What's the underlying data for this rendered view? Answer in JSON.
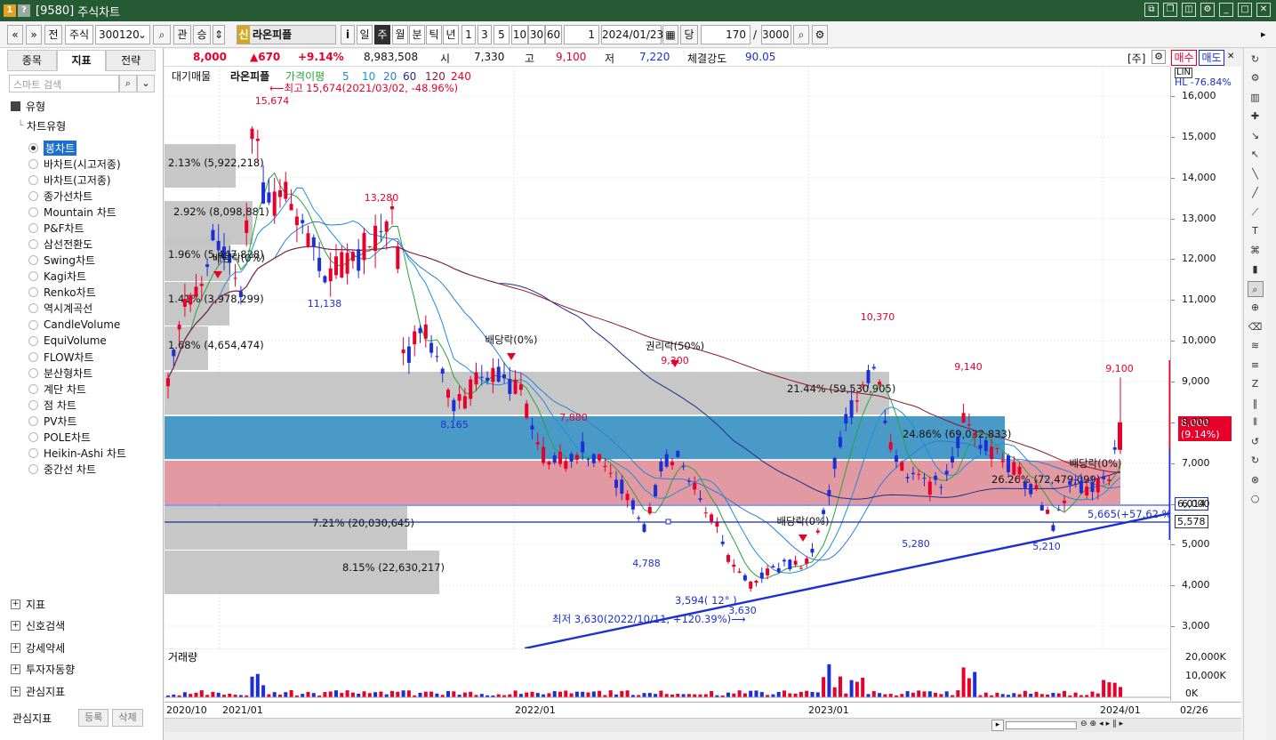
{
  "window": {
    "code": "[9580]",
    "title": "주식차트",
    "badges": [
      "1",
      "?"
    ]
  },
  "toolbar": {
    "nav_prev": "«",
    "nav_down": "»",
    "btn_prev": "전",
    "market": "주식",
    "code": "300120",
    "icon_search": "⌕",
    "btn_gwan": "관",
    "btn_sang": "승",
    "badge_sin": "신",
    "stock_name": "라온피플",
    "icon_info": "i",
    "periods": [
      "일",
      "주",
      "월",
      "분",
      "틱",
      "년"
    ],
    "active_period": "주",
    "intervals": [
      "1",
      "3",
      "5",
      "10",
      "30",
      "60"
    ],
    "count_small": "1",
    "date": "2024/01/23",
    "btn_dang": "당",
    "view_count": "170",
    "slash": "/",
    "total_count": "3000"
  },
  "sidebar": {
    "tabs": [
      "종목",
      "지표",
      "전략"
    ],
    "active_tab": "지표",
    "search_placeholder": "스마트 검색",
    "section_main": "유형",
    "group": "차트유형",
    "chart_types": [
      "봉차트",
      "바차트(시고저종)",
      "바차트(고저종)",
      "종가선차트",
      "Mountain 차트",
      "P&F차트",
      "삼선전환도",
      "Swing차트",
      "Kagi차트",
      "Renko차트",
      "역시계곡선",
      "CandleVolume",
      "EquiVolume",
      "FLOW차트",
      "분산형차트",
      "계단 차트",
      "점 차트",
      "PV차트",
      "POLE차트",
      "Heikin-Ashi 차트",
      "중간선 차트"
    ],
    "selected_type": "봉차트",
    "sections": [
      "지표",
      "신호검색",
      "강세약세",
      "투자자동향",
      "관심지표"
    ],
    "bottom_label": "관심지표",
    "btn_register": "등록",
    "btn_delete": "삭제"
  },
  "quote": {
    "price": "8,000",
    "change": "▲670",
    "change_pct": "+9.14%",
    "volume": "8,983,508",
    "open_label": "시",
    "open": "7,330",
    "high_label": "고",
    "high": "9,100",
    "low_label": "저",
    "low": "7,220",
    "strength_label": "체결강도",
    "strength": "90.05",
    "bracket": "[주]",
    "buy": "매수",
    "sell": "매도"
  },
  "legend": {
    "items": [
      "대기매물",
      "라온피플",
      "가격이평",
      "5",
      "10",
      "20",
      "60",
      "120",
      "240"
    ],
    "volume_label": "거래량"
  },
  "annotations": {
    "hl": "HL -76.84%",
    "max_note": "⟵최고 15,674(2021/03/02, -48.96%)",
    "min_note": "최저 3,630(2022/10/11, +120.39%)⟶",
    "div1": "배당락(0%)",
    "div2": "배당락(0%)",
    "div3": "배당락(0%)",
    "div4": "배당락(0%)",
    "rights": "권리락(50%)",
    "trend": "5,665(+57.62 %)",
    "angle": "3,594( 12° )"
  },
  "price_labels": [
    "15,674",
    "13,280",
    "11,138",
    "8,165",
    "7,880",
    "9,300",
    "4,788",
    "3,630",
    "10,370",
    "5,280",
    "9,140",
    "5,210",
    "9,100"
  ],
  "supply_labels": [
    "2.13% (5,922,218)",
    "2.92% (8,098,881)",
    "1.96% (5,447,828)",
    "1.41% (3,978,299)",
    "1.68% (4,654,474)",
    "21.44% (59,530,905)",
    "24.86% (69,032,833)",
    "26.26% (72,479,099)",
    "7.21% (20,030,645)",
    "8.15% (22,630,217)"
  ],
  "yaxis": {
    "ticks": [
      "16,000",
      "15,000",
      "14,000",
      "13,000",
      "12,000",
      "11,000",
      "10,000",
      "9,000",
      "8,000",
      "7,000",
      "6,000",
      "5,000",
      "4,000",
      "3,000"
    ],
    "current_price": "8,000",
    "current_pct": "(9.14%)",
    "ma_tag1": "6,014",
    "ma_tag2": "5,578",
    "vol_ticks": [
      "20,000K",
      "10,000K",
      "0K"
    ]
  },
  "xaxis": {
    "labels": [
      "2020/10",
      "2021/01",
      "2022/01",
      "2023/01",
      "2024/01"
    ],
    "right_label": "02/26"
  },
  "chart_data": {
    "type": "candlestick",
    "interval": "weekly",
    "symbol": "라온피플",
    "ylim": [
      2500,
      16500
    ],
    "key_points": [
      {
        "label": "최고",
        "value": 15674,
        "date": "2021/03/02"
      },
      {
        "label": "최저",
        "value": 3630,
        "date": "2022/10/11"
      }
    ],
    "current": {
      "open": 7330,
      "high": 9100,
      "low": 7220,
      "close": 8000
    }
  },
  "colors": {
    "up": "#e8002b",
    "down": "#1c2fd6",
    "ma5": "#2aa33a",
    "ma10": "#1e8fd9",
    "ma20": "#2d7bd8",
    "ma60": "#1b2f8a",
    "ma120": "#8a1a32",
    "trend": "#1c2fd6"
  }
}
